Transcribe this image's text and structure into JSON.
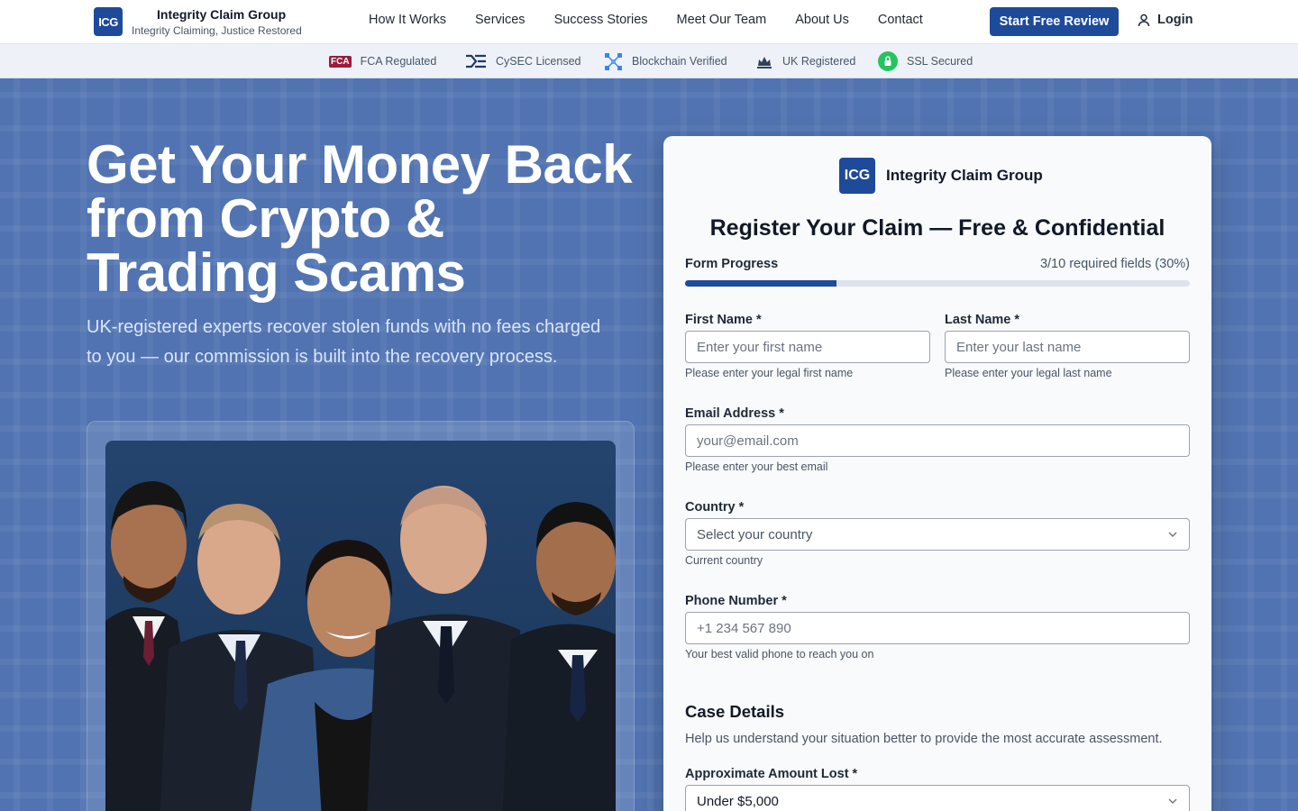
{
  "header": {
    "logo_text": "ICG",
    "brand_name": "Integrity Claim Group",
    "tagline": "Integrity Claiming, Justice Restored",
    "nav": [
      "How It Works",
      "Services",
      "Success Stories",
      "Meet Our Team",
      "About Us",
      "Contact"
    ],
    "cta_label": "Start Free Review",
    "login_label": "Login"
  },
  "trust_bar": {
    "items": [
      {
        "label": "FCA Regulated",
        "icon": "fca-logo-icon",
        "badge": "FCA"
      },
      {
        "label": "CySEC Licensed",
        "icon": "cysec-logo-icon"
      },
      {
        "label": "Blockchain Verified",
        "icon": "blockchain-icon"
      },
      {
        "label": "UK Registered",
        "icon": "uk-crown-icon"
      },
      {
        "label": "SSL Secured",
        "icon": "ssl-lock-icon"
      }
    ]
  },
  "hero": {
    "title": "Get Your Money Back from Crypto & Trading Scams",
    "subtitle": "UK-registered experts recover stolen funds with no fees charged to you — our commission is built into the recovery process."
  },
  "form": {
    "logo_text": "ICG",
    "brand_name": "Integrity Claim Group",
    "title": "Register Your Claim — Free & Confidential",
    "progress_label": "Form Progress",
    "progress_text": "3/10 required fields (30%)",
    "progress_fraction": 0.3,
    "first_name": {
      "label": "First Name *",
      "placeholder": "Enter your first name",
      "hint": "Please enter your legal first name"
    },
    "last_name": {
      "label": "Last Name *",
      "placeholder": "Enter your last name",
      "hint": "Please enter your legal last name"
    },
    "email": {
      "label": "Email Address *",
      "placeholder": "your@email.com",
      "hint": "Please enter your best email"
    },
    "country": {
      "label": "Country *",
      "placeholder": "Select your country",
      "hint": "Current country"
    },
    "phone": {
      "label": "Phone Number *",
      "placeholder": "+1 234 567 890",
      "hint": "Your best valid phone to reach you on"
    },
    "case_heading": "Case Details",
    "case_desc": "Help us understand your situation better to provide the most accurate assessment.",
    "amount": {
      "label": "Approximate Amount Lost *",
      "value": "Under $5,000"
    }
  },
  "colors": {
    "brand": "#1e4a9a",
    "hero_bg": "#1e4a9a",
    "fca": "#9b1c3c",
    "ssl": "#22c55e"
  }
}
